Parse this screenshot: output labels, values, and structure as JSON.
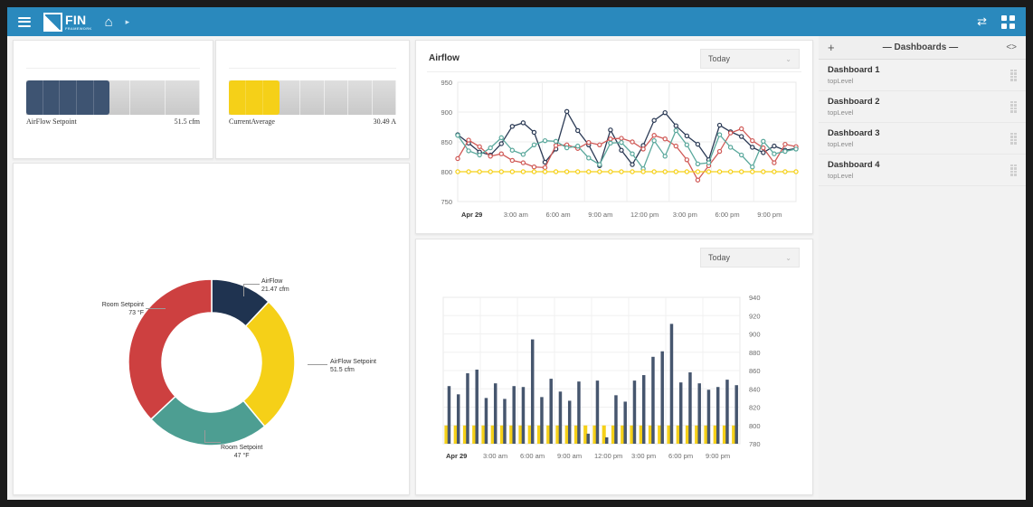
{
  "topbar": {
    "menu_icon": "hamburger-icon",
    "logo_text": "FIN",
    "logo_sub": "FRAMEWORK",
    "home_icon": "⌂",
    "caret_icon": "▸",
    "swap_icon": "⇄",
    "grid_icon": "grid-icon"
  },
  "gauges": [
    {
      "label": "AirFlow Setpoint",
      "value": "51.5 cfm",
      "fill_pct": 48,
      "color": "#3e5472",
      "segments": 5,
      "track_segments": 5
    },
    {
      "label": "CurrentAverage",
      "value": "30.49 A",
      "fill_pct": 30,
      "color": "#f5d018",
      "segments": 3,
      "track_segments": 7
    }
  ],
  "donut": {
    "slices": [
      {
        "name": "AirFlow",
        "value": "21.47 cfm",
        "color": "#1f3350",
        "pct": 12
      },
      {
        "name": "AirFlow Setpoint",
        "value": "51.5 cfm",
        "color": "#f5d018",
        "pct": 27
      },
      {
        "name": "Room Setpoint",
        "value": "47 °F",
        "color": "#4d9e92",
        "pct": 24
      },
      {
        "name": "Room Setpoint",
        "value": "73 °F",
        "color": "#cd4040",
        "pct": 37
      }
    ]
  },
  "line_chart": {
    "title": "Airflow",
    "range_label": "Today",
    "chevron": "⌄"
  },
  "bar_chart": {
    "range_label": "Today",
    "chevron": "⌄"
  },
  "sidebar": {
    "add_label": "+",
    "title": "— Dashboards —",
    "code_label": "<>",
    "items": [
      {
        "name": "Dashboard 1",
        "sub": "topLevel"
      },
      {
        "name": "Dashboard 2",
        "sub": "topLevel"
      },
      {
        "name": "Dashboard 3",
        "sub": "topLevel"
      },
      {
        "name": "Dashboard 4",
        "sub": "topLevel"
      }
    ]
  },
  "chart_data": [
    {
      "type": "line",
      "title": "Airflow",
      "xlabel": "",
      "ylabel": "",
      "ylim": [
        750,
        950
      ],
      "yticks": [
        750,
        800,
        850,
        900,
        950
      ],
      "xticks": [
        "Apr 29",
        "3:00 am",
        "6:00 am",
        "9:00 am",
        "12:00 pm",
        "3:00 pm",
        "6:00 pm",
        "9:00 pm"
      ],
      "grid": true,
      "legend": "none",
      "series": [
        {
          "name": "series-navy",
          "color": "#2b3a55",
          "values": [
            862,
            848,
            833,
            828,
            847,
            876,
            882,
            866,
            816,
            838,
            901,
            869,
            845,
            810,
            870,
            836,
            812,
            844,
            886,
            899,
            877,
            860,
            846,
            820,
            878,
            867,
            859,
            841,
            832,
            843,
            836,
            839
          ]
        },
        {
          "name": "series-red",
          "color": "#d05a57",
          "values": [
            822,
            853,
            842,
            826,
            830,
            819,
            815,
            808,
            807,
            844,
            845,
            839,
            849,
            845,
            855,
            856,
            850,
            838,
            861,
            855,
            843,
            820,
            786,
            810,
            834,
            865,
            872,
            852,
            840,
            815,
            846,
            842
          ]
        },
        {
          "name": "series-teal",
          "color": "#5aa89c",
          "values": [
            861,
            835,
            828,
            840,
            857,
            836,
            829,
            845,
            852,
            851,
            840,
            843,
            823,
            812,
            848,
            849,
            830,
            805,
            852,
            826,
            869,
            845,
            813,
            815,
            862,
            841,
            828,
            808,
            851,
            830,
            834,
            838
          ]
        },
        {
          "name": "series-yellow",
          "color": "#f5d018",
          "values": [
            800,
            800,
            800,
            800,
            800,
            800,
            800,
            800,
            800,
            800,
            800,
            800,
            800,
            800,
            800,
            800,
            800,
            800,
            800,
            800,
            800,
            800,
            800,
            800,
            800,
            800,
            800,
            800,
            800,
            800,
            800,
            800
          ]
        }
      ]
    },
    {
      "type": "bar",
      "title": "",
      "xlabel": "",
      "ylabel": "",
      "ylim": [
        780,
        940
      ],
      "yticks": [
        780,
        800,
        820,
        840,
        860,
        880,
        900,
        920,
        940
      ],
      "xticks": [
        "Apr 29",
        "3:00 am",
        "6:00 am",
        "9:00 am",
        "12:00 pm",
        "3:00 pm",
        "6:00 pm",
        "9:00 pm"
      ],
      "grid": true,
      "series": [
        {
          "name": "airflow-bars",
          "color": "#46566e",
          "values": [
            843,
            834,
            857,
            861,
            830,
            846,
            829,
            843,
            842,
            894,
            831,
            851,
            837,
            827,
            848,
            791,
            849,
            787,
            833,
            826,
            849,
            855,
            875,
            881,
            911,
            847,
            858,
            846,
            839,
            842,
            850,
            844
          ]
        },
        {
          "name": "setpoint-bars",
          "color": "#f5d018",
          "values": [
            800,
            800,
            800,
            800,
            800,
            800,
            800,
            800,
            800,
            800,
            800,
            800,
            800,
            800,
            800,
            800,
            800,
            800,
            800,
            800,
            800,
            800,
            800,
            800,
            800,
            800,
            800,
            800,
            800,
            800,
            800,
            800
          ]
        }
      ]
    },
    {
      "type": "pie",
      "title": "",
      "labels": [
        "AirFlow",
        "AirFlow Setpoint",
        "Room Setpoint",
        "Room Setpoint"
      ],
      "value_labels": [
        "21.47 cfm",
        "51.5 cfm",
        "47 °F",
        "73 °F"
      ],
      "values": [
        21.47,
        51.5,
        47,
        73
      ],
      "colors": [
        "#1f3350",
        "#f5d018",
        "#4d9e92",
        "#cd4040"
      ],
      "donut": true
    }
  ]
}
